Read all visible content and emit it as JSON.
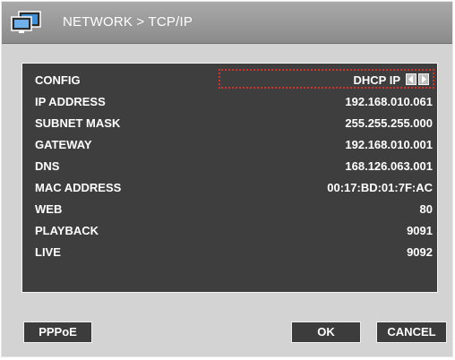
{
  "titlebar": {
    "icon": "network-monitor-icon",
    "title": "NETWORK > TCP/IP"
  },
  "fields": [
    {
      "label": "CONFIG",
      "value": "DHCP IP"
    },
    {
      "label": "IP ADDRESS",
      "value": "192.168.010.061"
    },
    {
      "label": "SUBNET MASK",
      "value": "255.255.255.000"
    },
    {
      "label": "GATEWAY",
      "value": "192.168.010.001"
    },
    {
      "label": "DNS",
      "value": "168.126.063.001"
    },
    {
      "label": "MAC ADDRESS",
      "value": "00:17:BD:01:7F:AC"
    },
    {
      "label": "WEB",
      "value": "80"
    },
    {
      "label": "PLAYBACK",
      "value": "9091"
    },
    {
      "label": "LIVE",
      "value": "9092"
    }
  ],
  "buttons": {
    "pppoe": "PPPoE",
    "ok": "OK",
    "cancel": "CANCEL"
  },
  "colors": {
    "panel": "#3e3e3e",
    "window": "#d3d3d3",
    "focus": "#d0342c"
  }
}
